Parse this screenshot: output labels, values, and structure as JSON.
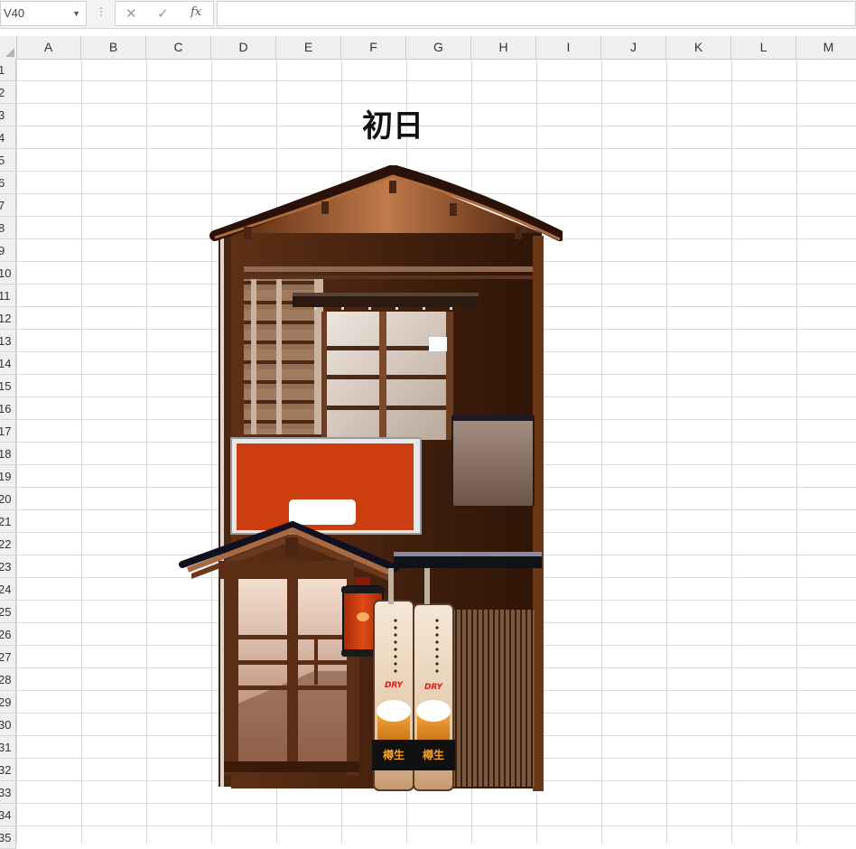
{
  "formula_bar": {
    "name_box": "V40",
    "cancel_symbol": "✕",
    "enter_symbol": "✓",
    "function_symbol": "fx",
    "formula": ""
  },
  "columns": [
    "A",
    "B",
    "C",
    "D",
    "E",
    "F",
    "G",
    "H",
    "I",
    "J",
    "K",
    "L",
    "M"
  ],
  "rows": [
    "1",
    "2",
    "3",
    "4",
    "5",
    "6",
    "7",
    "8",
    "9",
    "10",
    "11",
    "12",
    "13",
    "14",
    "15",
    "16",
    "17",
    "18",
    "19",
    "20",
    "21",
    "22",
    "23",
    "24",
    "25",
    "26",
    "27",
    "28",
    "29",
    "30",
    "31",
    "32",
    "33",
    "34",
    "35"
  ],
  "sheet": {
    "title": "初日"
  },
  "picture": {
    "banner_left_text": "DRY",
    "banner_right_text": "DRY",
    "banner_left_label": "樽生",
    "banner_right_label": "樽生"
  },
  "colors": {
    "sign_orange": "#cc3d10",
    "lantern_red": "#d63a12",
    "wood_dark": "#3d1c0a",
    "wood_mid": "#7a4424"
  }
}
